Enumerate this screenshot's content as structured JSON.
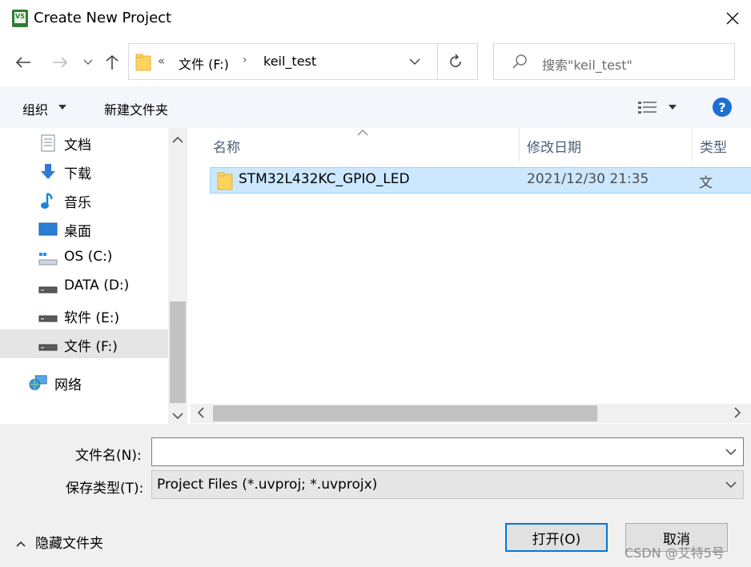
{
  "window": {
    "title": "Create New Project"
  },
  "nav": {
    "breadcrumb_overflow": "«",
    "breadcrumb": [
      "文件 (F:)",
      "keil_test"
    ],
    "breadcrumb_arrow": "›",
    "search_placeholder": "搜索\"keil_test\""
  },
  "toolbar": {
    "organize_label": "组织",
    "new_folder_label": "新建文件夹"
  },
  "sidebar": {
    "items": [
      {
        "label": "文档",
        "icon": "document-icon"
      },
      {
        "label": "下载",
        "icon": "download-icon"
      },
      {
        "label": "音乐",
        "icon": "music-icon"
      },
      {
        "label": "桌面",
        "icon": "desktop-icon"
      },
      {
        "label": "OS (C:)",
        "icon": "os-drive-icon"
      },
      {
        "label": "DATA (D:)",
        "icon": "drive-icon"
      },
      {
        "label": "软件 (E:)",
        "icon": "drive-icon"
      },
      {
        "label": "文件 (F:)",
        "icon": "drive-icon",
        "selected": true
      },
      {
        "label": "网络",
        "icon": "network-icon"
      }
    ]
  },
  "file_list": {
    "columns": [
      "名称",
      "修改日期",
      "类型"
    ],
    "rows": [
      {
        "name": "STM32L432KC_GPIO_LED",
        "modified": "2021/12/30 21:35",
        "type": "文",
        "selected": true
      }
    ]
  },
  "form": {
    "filename_label": "文件名(N):",
    "filename_value": "",
    "filetype_label": "保存类型(T):",
    "filetype_value": "Project Files (*.uvproj; *.uvprojx)"
  },
  "footer": {
    "hide_folders_label": "隐藏文件夹",
    "open_label": "打开(O)",
    "cancel_label": "取消",
    "watermark": "CSDN @艾特5号"
  },
  "colors": {
    "selection_bg": "#cce8ff",
    "selection_border": "#99d1ff",
    "accent": "#0078d7",
    "folder": "#ffd35c"
  }
}
